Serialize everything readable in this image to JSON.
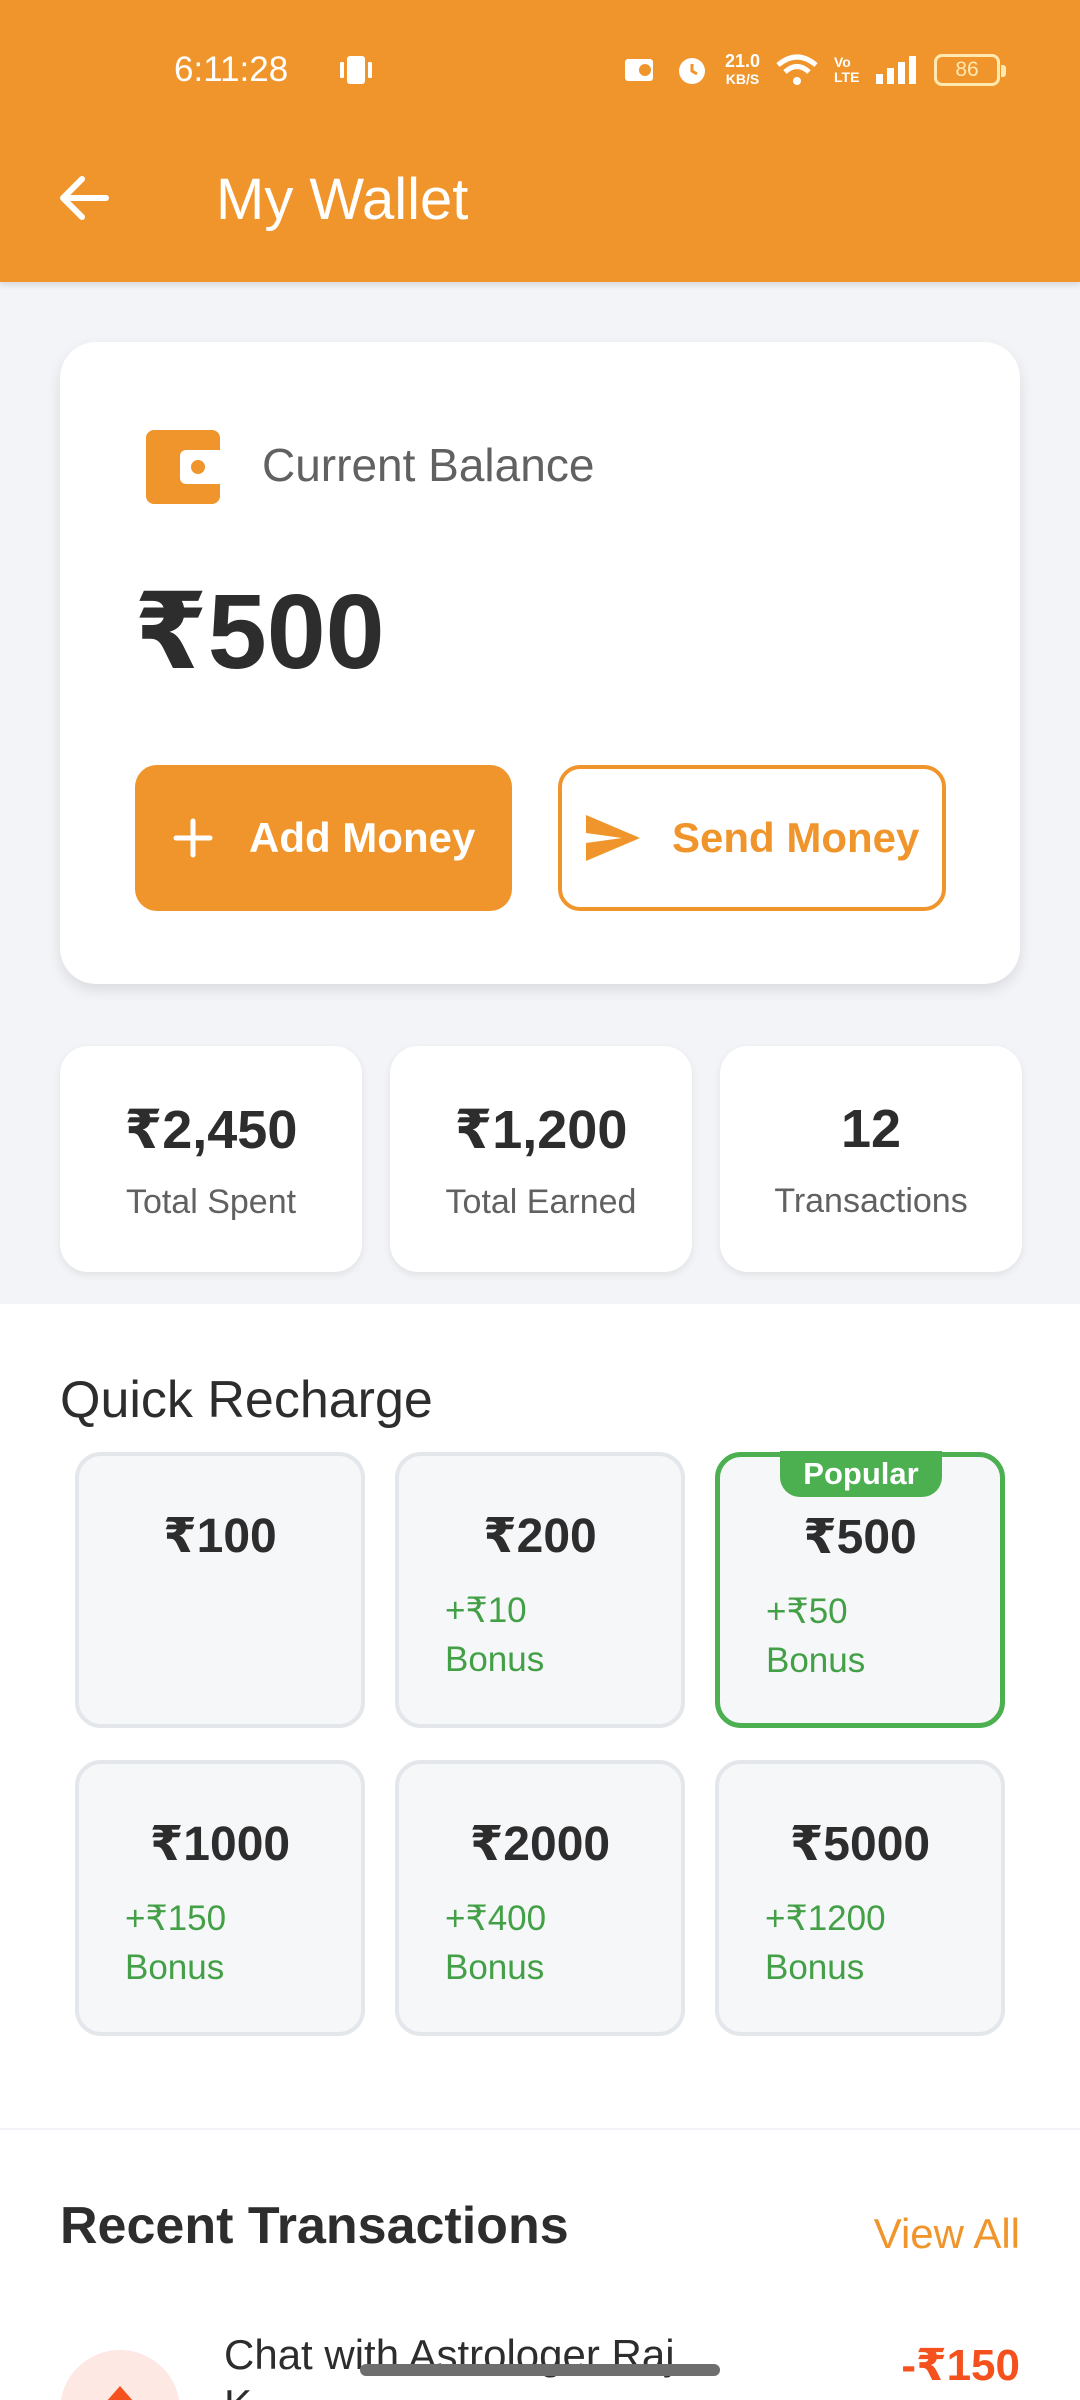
{
  "status_bar": {
    "time": "6:11:28",
    "net_speed_value": "21.0",
    "net_speed_unit": "KB/S",
    "volte": "Vo LTE",
    "battery": "86"
  },
  "header": {
    "title": "My Wallet"
  },
  "balance": {
    "label": "Current Balance",
    "amount": "₹500",
    "add_money_label": "Add Money",
    "send_money_label": "Send Money"
  },
  "stats": [
    {
      "value": "₹2,450",
      "label": "Total Spent"
    },
    {
      "value": "₹1,200",
      "label": "Total Earned"
    },
    {
      "value": "12",
      "label": "Transactions"
    }
  ],
  "quick_recharge": {
    "title": "Quick Recharge",
    "popular_badge": "Popular",
    "packs": [
      {
        "amount": "₹100",
        "bonus_amount": "",
        "bonus_word": ""
      },
      {
        "amount": "₹200",
        "bonus_amount": "+₹10",
        "bonus_word": "Bonus"
      },
      {
        "amount": "₹500",
        "bonus_amount": "+₹50",
        "bonus_word": "Bonus",
        "popular": true
      },
      {
        "amount": "₹1000",
        "bonus_amount": "+₹150",
        "bonus_word": "Bonus"
      },
      {
        "amount": "₹2000",
        "bonus_amount": "+₹400",
        "bonus_word": "Bonus"
      },
      {
        "amount": "₹5000",
        "bonus_amount": "+₹1200",
        "bonus_word": "Bonus"
      }
    ]
  },
  "recent_transactions": {
    "title": "Recent Transactions",
    "view_all_label": "View All",
    "items": [
      {
        "name": "Chat with Astrologer Raj K...",
        "amount": "-₹150"
      }
    ]
  },
  "colors": {
    "accent": "#f0952c",
    "bonus_green": "#43a047",
    "popular_green": "#4caf50",
    "debit_red": "#f4511e"
  }
}
